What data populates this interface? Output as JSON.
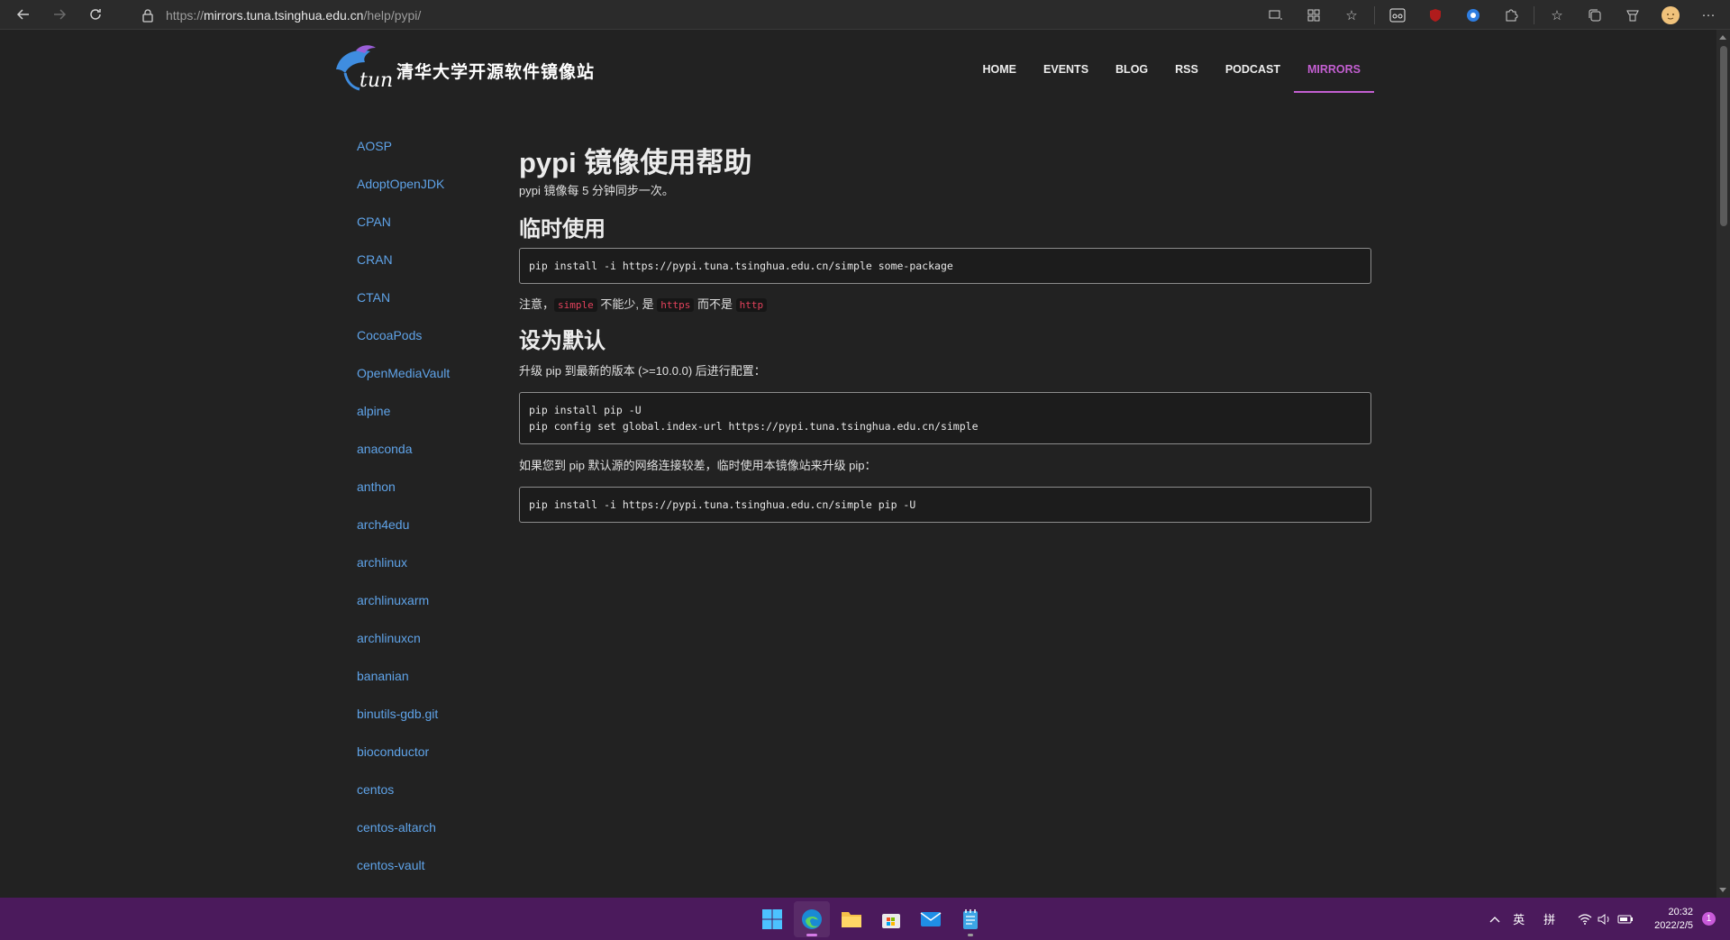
{
  "browser": {
    "url_prefix": "https://",
    "url_host": "mirrors.tuna.tsinghua.edu.cn",
    "url_path": "/help/pypi/"
  },
  "site": {
    "logo_text": "tuna",
    "title": "清华大学开源软件镜像站",
    "nav": [
      "HOME",
      "EVENTS",
      "BLOG",
      "RSS",
      "PODCAST",
      "MIRRORS"
    ],
    "active_nav": "MIRRORS",
    "accent_color": "#c35fd1",
    "link_color": "#5fa3e8"
  },
  "sidebar": {
    "items": [
      "AOSP",
      "AdoptOpenJDK",
      "CPAN",
      "CRAN",
      "CTAN",
      "CocoaPods",
      "OpenMediaVault",
      "alpine",
      "anaconda",
      "anthon",
      "arch4edu",
      "archlinux",
      "archlinuxarm",
      "archlinuxcn",
      "bananian",
      "binutils-gdb.git",
      "bioconductor",
      "centos",
      "centos-altarch",
      "centos-vault"
    ]
  },
  "content": {
    "title": "pypi 镜像使用帮助",
    "intro": "pypi 镜像每 5 分钟同步一次。",
    "temp_heading": "临时使用",
    "temp_code": "pip install -i https://pypi.tuna.tsinghua.edu.cn/simple some-package",
    "note_prefix": "注意，",
    "note_code1": "simple",
    "note_mid1": " 不能少, 是 ",
    "note_code2": "https",
    "note_mid2": " 而不是 ",
    "note_code3": "http",
    "default_heading": "设为默认",
    "default_desc": "升级 pip 到最新的版本 (>=10.0.0) 后进行配置：",
    "default_code_line1": "pip install pip -U",
    "default_code_line2": "pip config set global.index-url https://pypi.tuna.tsinghua.edu.cn/simple",
    "slow_desc": "如果您到 pip 默认源的网络连接较差，临时使用本镜像站来升级 pip：",
    "slow_code": "pip install -i https://pypi.tuna.tsinghua.edu.cn/simple pip -U"
  },
  "taskbar": {
    "apps": [
      "start",
      "edge",
      "file-explorer",
      "store",
      "mail",
      "notepad"
    ],
    "tray_ime1": "英",
    "tray_ime2": "拼",
    "time": "20:32",
    "date": "2022/2/5",
    "notification_count": "1",
    "background": "#4b1a5c"
  }
}
